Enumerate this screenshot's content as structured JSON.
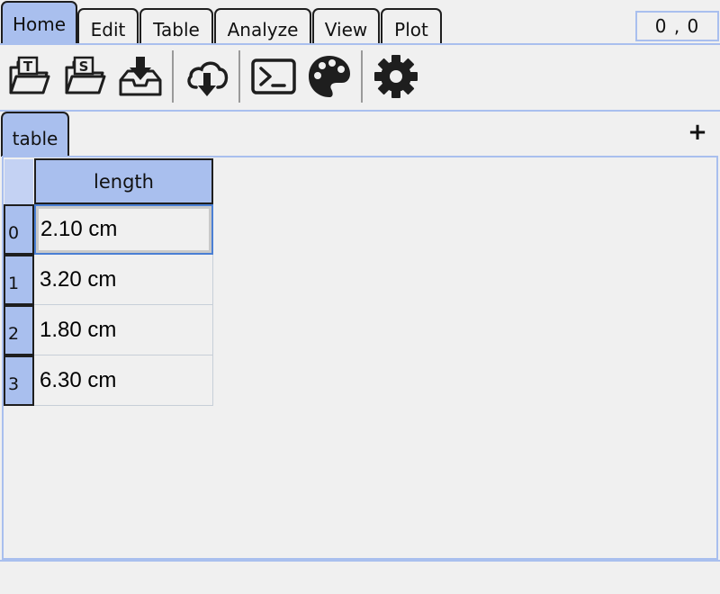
{
  "menu": {
    "tabs": [
      {
        "label": "Home",
        "active": true
      },
      {
        "label": "Edit"
      },
      {
        "label": "Table"
      },
      {
        "label": "Analyze"
      },
      {
        "label": "View"
      },
      {
        "label": "Plot"
      }
    ],
    "coords": "0 , 0"
  },
  "toolbar": {
    "buttons": [
      {
        "icon": "open-text-folder-icon",
        "glyph": "T"
      },
      {
        "icon": "open-session-folder-icon",
        "glyph": "S"
      },
      {
        "icon": "download-tray-icon"
      },
      {
        "icon": "cloud-download-icon"
      },
      {
        "icon": "terminal-icon"
      },
      {
        "icon": "palette-icon"
      },
      {
        "icon": "gear-icon"
      }
    ]
  },
  "sheets": {
    "tabs": [
      {
        "label": "table"
      }
    ],
    "add_label": "+"
  },
  "table": {
    "columns": [
      "length"
    ],
    "rows": [
      {
        "index": "0",
        "value": "2.10 cm"
      },
      {
        "index": "1",
        "value": "3.20 cm"
      },
      {
        "index": "2",
        "value": "1.80 cm"
      },
      {
        "index": "3",
        "value": "6.30 cm"
      }
    ],
    "selected_row": 0
  },
  "colors": {
    "accent": "#a9bfee",
    "border": "#1e1e1e",
    "selection": "#4a7fd4",
    "background": "#f0f0f0"
  }
}
